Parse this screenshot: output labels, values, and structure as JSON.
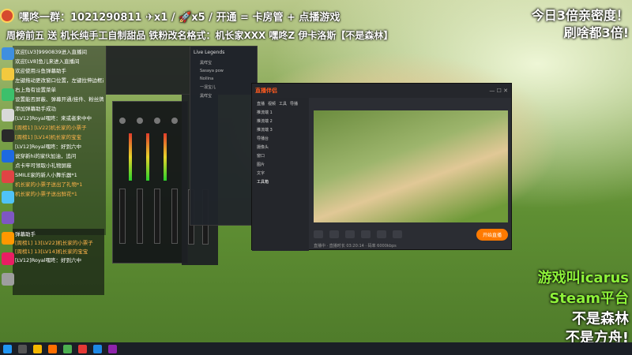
{
  "overlay": {
    "top_line": "嘿咚一群：1021290811  ✈x1  / 🚀x5 / 开通  = 卡房管 + 点播游戏",
    "second_line": "周榜前五  送  机长纯手工自制甜品  铁粉改名格式：机长家XXX  嘿咚Z 伊卡洛斯【不是森林】",
    "top_right_1": "今日3倍亲密度！",
    "top_right_2": "刷啥都3倍!",
    "bottom_right": [
      "游戏叫icarus",
      "Steam平台",
      "不是森林",
      "不是方舟!"
    ]
  },
  "chat": {
    "lines": [
      {
        "text": "欢迎[LV3]9990839进入直播间",
        "orange": false
      },
      {
        "text": "欢迎[LV8]鱼儿来进入直播间",
        "orange": false
      },
      {
        "text": "欢迎使用斗鱼弹幕助手",
        "orange": false
      },
      {
        "text": "左键拖动更改窗口位置，左键拉伸边框改变大小",
        "orange": false
      },
      {
        "text": "右上角有设置菜单",
        "orange": false
      },
      {
        "text": "设置能否屏蔽、弹幕开通/挂件、粉丝牌开关等",
        "orange": false
      },
      {
        "text": "添加弹幕助手成功",
        "orange": false
      },
      {
        "text": "[LV12]Royal嘿咚：来或者来中中",
        "orange": false
      },
      {
        "text": "[周榜1] [LV22]机长家的小票子",
        "orange": true
      },
      {
        "text": "[周榜1] [LV14]机长家的宝宝",
        "orange": true
      },
      {
        "text": "[LV12]Royal嘿咚：好到六中",
        "orange": false
      },
      {
        "text": "说穿新hi的家伙加油，追问",
        "orange": false
      },
      {
        "text": "点卡牢可领取小礼物屏蔽",
        "orange": false
      },
      {
        "text": "SMILE家的新人小舞乐器*1",
        "orange": false
      },
      {
        "text": "机长家的小票子送出了礼物*1",
        "orange": true
      },
      {
        "text": "机长家的小票子送出鲜花*1",
        "orange": true
      }
    ]
  },
  "chat2": {
    "header": "弹幕助手",
    "lines": [
      {
        "text": "[周榜1] 13[LV22]机长家的小票子",
        "orange": true
      },
      {
        "text": "[周榜1] 13[LV14]机长家的宝宝",
        "orange": true
      },
      {
        "text": "[LV12]Royal嘿咚：好到六中",
        "orange": false
      }
    ]
  },
  "panel": {
    "title": "Live Legends",
    "rows": [
      "黑咩宝",
      "Sasaya pow",
      "Nollina",
      "一凛宝儿",
      "黑咩宝"
    ]
  },
  "app": {
    "name": "直播伴侣",
    "tabs": [
      "直播",
      "视频",
      "工具",
      "导播"
    ],
    "side_items": [
      "推流端 1",
      "推流端 2",
      "推流端 3",
      "导播台",
      "摄像头",
      "窗口",
      "图片",
      "文字"
    ],
    "tools_label": "工具箱",
    "status_line": "直播中 · 直播时长 03:20:14 · 码率 6000kbps",
    "start_button": "开始直播",
    "bottom_tools": [
      "直播场景",
      "主播互动",
      "分享",
      "设置",
      "美颜",
      "弹幕",
      "滤镜",
      "录屏"
    ]
  },
  "colors": {
    "accent_orange": "#ff7a00",
    "caption_green": "#8ef23a"
  }
}
